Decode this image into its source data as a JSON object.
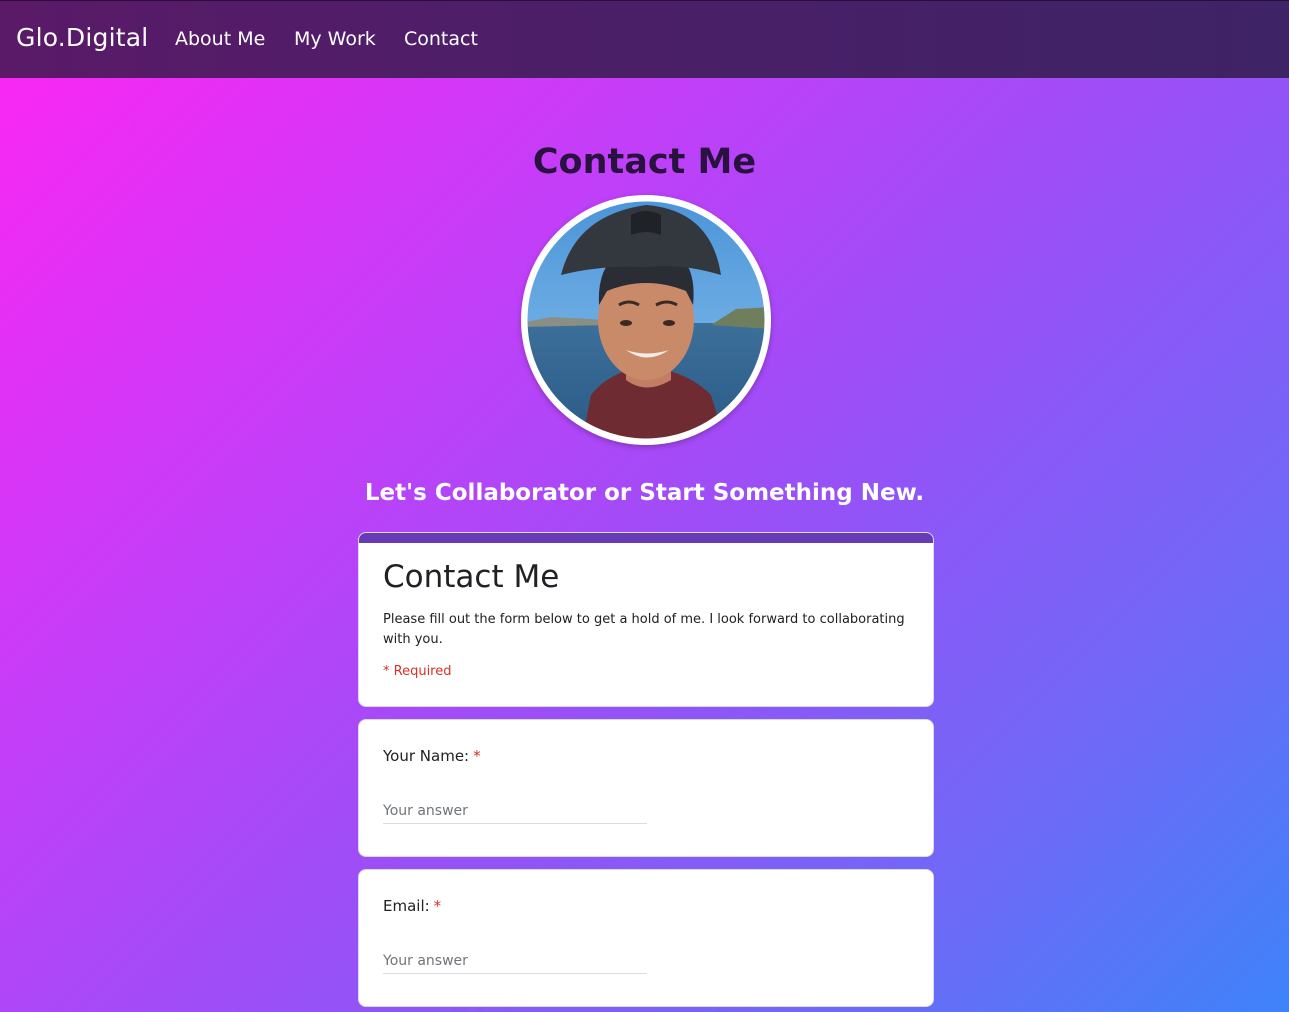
{
  "navbar": {
    "brand": "Glo.Digital",
    "links": [
      {
        "label": "About Me"
      },
      {
        "label": "My Work"
      },
      {
        "label": "Contact"
      }
    ]
  },
  "hero": {
    "title": "Contact Me",
    "tagline": "Let's Collaborator or Start Something New."
  },
  "form": {
    "accent_color": "#673ab7",
    "title": "Contact Me",
    "description": "Please fill out the form below to get a hold of me. I look forward to collaborating with you.",
    "required_note": "* Required",
    "questions": [
      {
        "label": "Your Name:",
        "required_mark": "*",
        "placeholder": "Your answer"
      },
      {
        "label": "Email:",
        "required_mark": "*",
        "placeholder": "Your answer"
      }
    ]
  },
  "colors": {
    "required_red": "#d93025",
    "navbar_bg": "#4a1f68",
    "title_color": "#2a1240"
  }
}
